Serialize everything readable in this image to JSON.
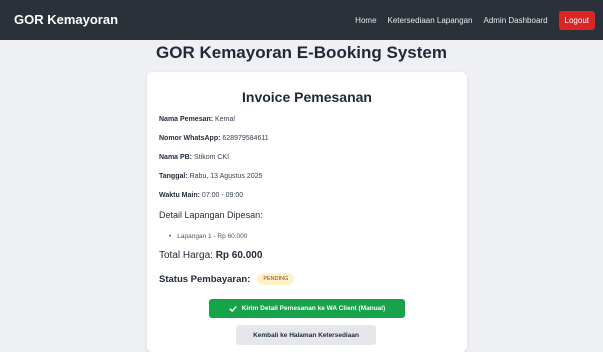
{
  "navbar": {
    "brand": "GOR Kemayoran",
    "links": [
      "Home",
      "Ketersediaan Lapangan",
      "Admin Dashboard"
    ],
    "logout": "Logout",
    "colors": {
      "background": "#2b3138",
      "logout": "#dc2626"
    }
  },
  "page": {
    "title": "GOR Kemayoran E-Booking System"
  },
  "invoice": {
    "title": "Invoice Pemesanan",
    "fields": [
      {
        "label": "Nama Pemesan:",
        "value": "Kemal"
      },
      {
        "label": "Nomor WhatsApp:",
        "value": "628979584611"
      },
      {
        "label": "Nama PB:",
        "value": "Stikom CKI"
      },
      {
        "label": "Tanggal:",
        "value": "Rabu, 13 Agustus 2025"
      },
      {
        "label": "Waktu Main:",
        "value": "07:00 - 09:00"
      }
    ],
    "detail_title": "Detail Lapangan Dipesan:",
    "courts": [
      "Lapangan 1 - Rp 60.000"
    ],
    "total_label": "Total Harga:",
    "total_value": "Rp 60.000",
    "status_label": "Status Pembayaran:",
    "status_value": "PENDING",
    "wa_button": "Kirim Detail Pemesanan ke WA Client (Manual)",
    "wa_icon": "check-icon",
    "back_button": "Kembali ke Halaman Ketersediaan",
    "colors": {
      "wa_button": "#16a34a",
      "badge_bg": "#fef3c7",
      "badge_text": "#92400e"
    }
  }
}
